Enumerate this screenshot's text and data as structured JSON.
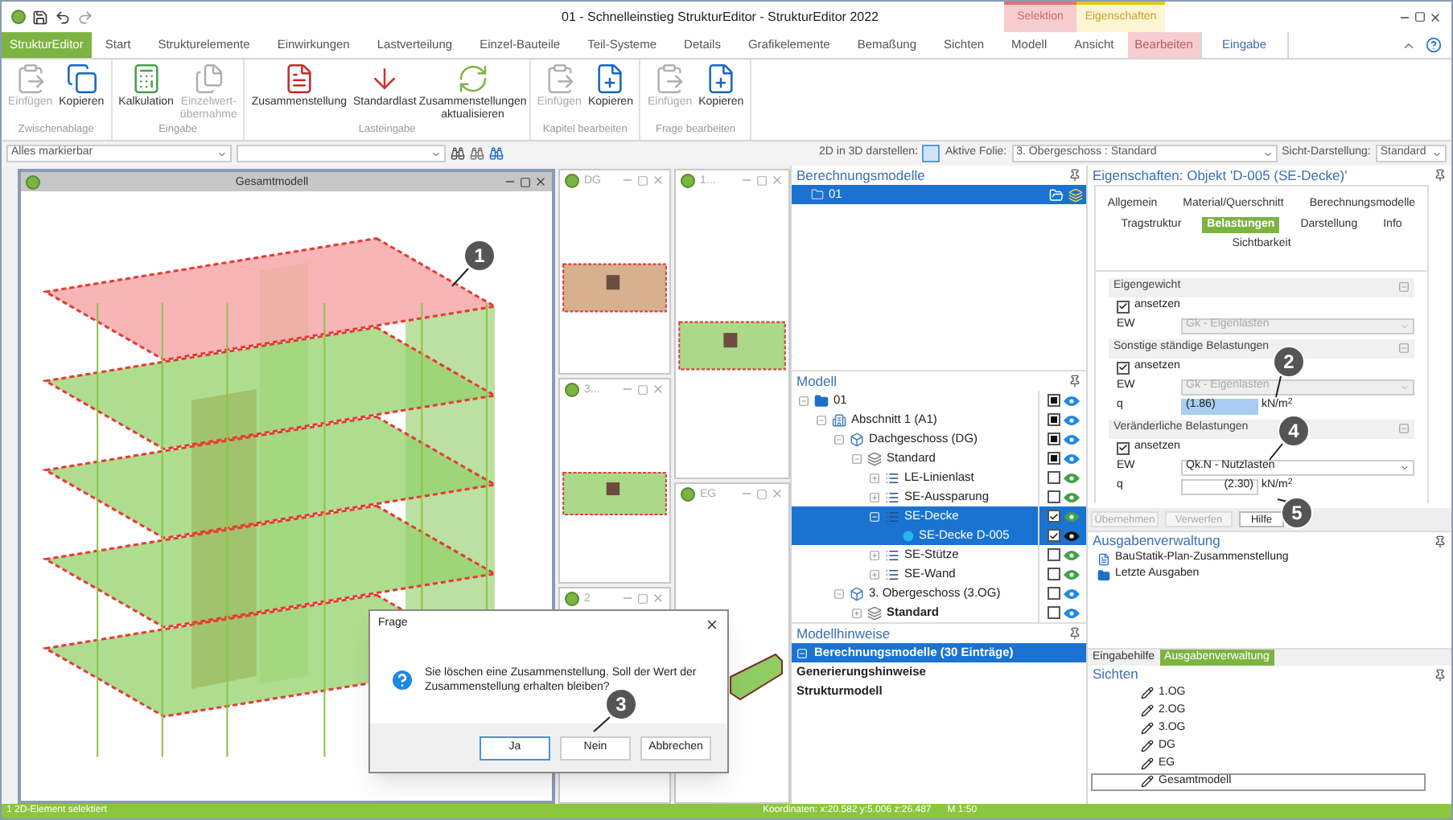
{
  "window": {
    "title": "01 - Schnelleinstieg StrukturEditor - StrukturEditor 2022"
  },
  "context_groups": [
    {
      "label": "Selektion",
      "kind": "selektion"
    },
    {
      "label": "Eigenschaften",
      "kind": "eigenschaften"
    }
  ],
  "ribbon_tabs": [
    {
      "label": "StrukturEditor",
      "kind": "file",
      "selected": false
    },
    {
      "label": "Start",
      "kind": "normal",
      "selected": false
    },
    {
      "label": "Strukturelemente",
      "kind": "normal",
      "selected": false
    },
    {
      "label": "Einwirkungen",
      "kind": "normal",
      "selected": false
    },
    {
      "label": "Lastverteilung",
      "kind": "normal",
      "selected": false
    },
    {
      "label": "Einzel-Bauteile",
      "kind": "normal",
      "selected": false
    },
    {
      "label": "Teil-Systeme",
      "kind": "normal",
      "selected": false
    },
    {
      "label": "Details",
      "kind": "normal",
      "selected": false
    },
    {
      "label": "Grafikelemente",
      "kind": "normal",
      "selected": false
    },
    {
      "label": "Bemaßung",
      "kind": "normal",
      "selected": false
    },
    {
      "label": "Sichten",
      "kind": "normal",
      "selected": false
    },
    {
      "label": "Modell",
      "kind": "normal",
      "selected": false
    },
    {
      "label": "Ansicht",
      "kind": "normal",
      "selected": false
    },
    {
      "label": "Bearbeiten",
      "kind": "selektion",
      "selected": false
    },
    {
      "label": "Eingabe",
      "kind": "eigenschaften",
      "selected": true
    }
  ],
  "ribbon_groups": [
    {
      "label": "Zwischenablage",
      "buttons": [
        {
          "label": "Einfügen",
          "kind": "paste",
          "disabled": true
        },
        {
          "label": "Kopieren",
          "kind": "copy",
          "disabled": false
        }
      ]
    },
    {
      "label": "Eingabe",
      "buttons": [
        {
          "label": "Kalkulation",
          "kind": "calc",
          "disabled": false
        },
        {
          "label": "Einzelwert-\nübernahme",
          "kind": "pages",
          "disabled": true
        }
      ]
    },
    {
      "label": "Lasteingabe",
      "buttons": [
        {
          "label": "Zusammenstellung",
          "kind": "list",
          "disabled": false
        },
        {
          "label": "Standardlast",
          "kind": "load",
          "disabled": false
        },
        {
          "label": "Zusammenstellungen aktualisieren",
          "kind": "refresh",
          "disabled": false
        }
      ]
    },
    {
      "label": "Kapitel bearbeiten",
      "buttons": [
        {
          "label": "Einfügen",
          "kind": "paste",
          "disabled": true
        },
        {
          "label": "Kopieren",
          "kind": "copyplus",
          "disabled": false
        }
      ]
    },
    {
      "label": "Frage bearbeiten",
      "buttons": [
        {
          "label": "Einfügen",
          "kind": "paste",
          "disabled": true
        },
        {
          "label": "Kopieren",
          "kind": "copyplus",
          "disabled": false
        }
      ]
    }
  ],
  "toolbar": {
    "filter": "Alles markierbar",
    "show_2d_label": "2D in 3D darstellen:",
    "active_layer_label": "Aktive Folie:",
    "active_layer": "3. Obergeschoss : Standard",
    "view_label": "Sicht-Darstellung:",
    "view": "Standard"
  },
  "viewports": [
    {
      "title": "Gesamtmodell",
      "active": true
    },
    {
      "title": "DG",
      "active": false
    },
    {
      "title": "3...",
      "active": false
    },
    {
      "title": "2",
      "active": false
    },
    {
      "title": "1...",
      "active": false
    },
    {
      "title": "EG",
      "active": false
    }
  ],
  "dialog": {
    "title": "Frage",
    "message": "Sie löschen eine Zusammenstellung. Soll der Wert der Zusammenstellung erhalten bleiben?",
    "buttons": [
      {
        "label": "Ja",
        "default": true
      },
      {
        "label": "Nein",
        "default": false
      },
      {
        "label": "Abbrechen",
        "default": false
      }
    ]
  },
  "calc_models": {
    "title": "Berechnungsmodelle",
    "items": [
      {
        "label": "01",
        "selected": true
      }
    ]
  },
  "model": {
    "title": "Modell",
    "tree": [
      {
        "label": "01",
        "kind": "folder",
        "expanded": true,
        "selected": false,
        "checked": true,
        "mixed": true,
        "color": "#1e88e5",
        "children": [
          {
            "label": "Abschnitt 1 (A1)",
            "kind": "building",
            "expanded": true,
            "selected": false,
            "checked": true,
            "mixed": true,
            "color": "#1e88e5",
            "children": [
              {
                "label": "Dachgeschoss (DG)",
                "kind": "floor",
                "expanded": true,
                "selected": false,
                "checked": true,
                "mixed": true,
                "color": "#1e88e5",
                "children": [
                  {
                    "label": "Standard",
                    "kind": "layer",
                    "expanded": true,
                    "selected": false,
                    "checked": true,
                    "mixed": true,
                    "color": "#1e88e5",
                    "children": [
                      {
                        "label": "LE-Linienlast",
                        "kind": "list",
                        "expanded": false,
                        "selected": false,
                        "checked": false,
                        "mixed": false,
                        "color": "#43a047"
                      },
                      {
                        "label": "SE-Aussparung",
                        "kind": "list",
                        "expanded": false,
                        "selected": false,
                        "checked": false,
                        "mixed": false,
                        "color": "#43a047"
                      },
                      {
                        "label": "SE-Decke",
                        "kind": "list",
                        "expanded": true,
                        "selected": true,
                        "checked": true,
                        "mixed": false,
                        "color": "#43a047",
                        "children": [
                          {
                            "label": "SE-Decke D-005",
                            "kind": "item",
                            "selected": true,
                            "checked": true,
                            "mixed": false,
                            "color": "#111111"
                          }
                        ]
                      },
                      {
                        "label": "SE-Stütze",
                        "kind": "list",
                        "expanded": false,
                        "selected": false,
                        "checked": false,
                        "mixed": false,
                        "color": "#43a047"
                      },
                      {
                        "label": "SE-Wand",
                        "kind": "list",
                        "expanded": false,
                        "selected": false,
                        "checked": false,
                        "mixed": false,
                        "color": "#43a047"
                      }
                    ]
                  }
                ]
              },
              {
                "label": "3. Obergeschoss (3.OG)",
                "kind": "floor",
                "expanded": true,
                "selected": false,
                "checked": false,
                "mixed": false,
                "color": "#1e88e5",
                "children": [
                  {
                    "label": "Standard",
                    "kind": "layer",
                    "expanded": false,
                    "active": true,
                    "selected": false,
                    "checked": false,
                    "mixed": false,
                    "color": "#1e88e5"
                  }
                ]
              }
            ]
          }
        ]
      }
    ]
  },
  "model_notes": {
    "title": "Modellhinweise",
    "items": [
      {
        "label": "Berechnungsmodelle (30 Einträge)",
        "selected": true
      },
      {
        "label": "Generierungshinweise",
        "selected": false
      },
      {
        "label": "Strukturmodell",
        "selected": false
      }
    ]
  },
  "properties": {
    "title": "Eigenschaften: Objekt 'D-005 (SE-Decke)'",
    "tab_rows": [
      [
        {
          "label": "Allgemein",
          "selected": false
        },
        {
          "label": "Material/Querschnitt",
          "selected": false
        },
        {
          "label": "Berechnungsmodelle",
          "selected": false
        }
      ],
      [
        {
          "label": "Tragstruktur",
          "selected": false
        },
        {
          "label": "Belastungen",
          "selected": true
        },
        {
          "label": "Darstellung",
          "selected": false
        },
        {
          "label": "Info",
          "selected": false
        }
      ],
      [
        {
          "label": "Sichtbarkeit",
          "selected": false
        }
      ]
    ],
    "sections": [
      {
        "title": "Eigengewicht",
        "fields": [
          {
            "kind": "checkbox",
            "label": "ansetzen",
            "checked": true
          },
          {
            "kind": "select",
            "label": "EW",
            "value": "Gk - Eigenlasten",
            "disabled": true
          }
        ]
      },
      {
        "title": "Sonstige ständige Belastungen",
        "fields": [
          {
            "kind": "checkbox",
            "label": "ansetzen",
            "checked": true
          },
          {
            "kind": "select",
            "label": "EW",
            "value": "Gk - Eigenlasten",
            "disabled": true
          },
          {
            "kind": "number",
            "label": "q",
            "value": "(1.86)",
            "unit": "kN/m$^{2}$",
            "selected": true
          }
        ]
      },
      {
        "title": "Veränderliche Belastungen",
        "fields": [
          {
            "kind": "checkbox",
            "label": "ansetzen",
            "checked": true
          },
          {
            "kind": "select",
            "label": "EW",
            "value": "Qk.N - Nutzlasten",
            "disabled": false
          },
          {
            "kind": "number",
            "label": "q",
            "value": "(2.30)",
            "unit": "kN/m$^{2}$",
            "selected": false
          }
        ]
      }
    ],
    "buttons": [
      {
        "label": "Übernehmen",
        "disabled": true
      },
      {
        "label": "Verwerfen",
        "disabled": true
      },
      {
        "label": "Hilfe",
        "disabled": false
      }
    ]
  },
  "output_manager": {
    "title": "Ausgabenverwaltung",
    "items": [
      {
        "label": "BauStatik-Plan-Zusammenstellung",
        "kind": "plan"
      },
      {
        "label": "Letzte Ausgaben",
        "kind": "folder"
      }
    ]
  },
  "bottom_tabs": [
    {
      "label": "Eingabehilfe",
      "selected": false
    },
    {
      "label": "Ausgabenverwaltung",
      "selected": true
    }
  ],
  "views": {
    "title": "Sichten",
    "items": [
      {
        "label": "1.OG",
        "selected": false
      },
      {
        "label": "2.OG",
        "selected": false
      },
      {
        "label": "3.OG",
        "selected": false
      },
      {
        "label": "DG",
        "selected": false
      },
      {
        "label": "EG",
        "selected": false
      },
      {
        "label": "Gesamtmodell",
        "selected": true
      }
    ]
  },
  "callouts": [
    {
      "label": "1"
    },
    {
      "label": "2"
    },
    {
      "label": "3"
    },
    {
      "label": "4"
    },
    {
      "label": "5"
    }
  ],
  "status_bar": {
    "left": "1 2D-Element selektiert",
    "coordinates": "Koordinaten: x:20.582 y:5.006 z:26.487",
    "scale": "M 1:50"
  }
}
